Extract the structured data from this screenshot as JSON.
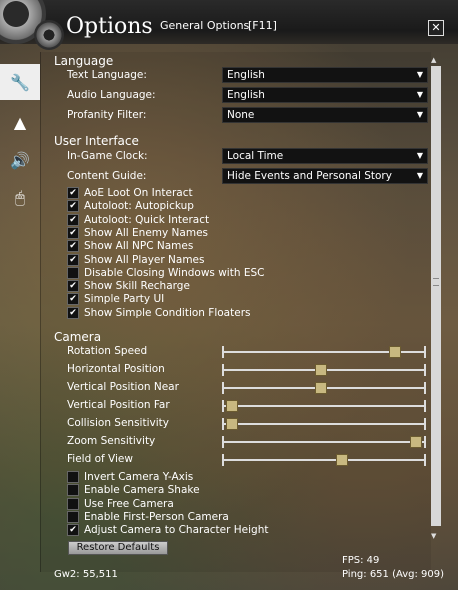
{
  "window": {
    "title": "Options",
    "subtitle": "General Options",
    "hotkey": "[F11]",
    "close_glyph": "✕"
  },
  "sidebar": {
    "tabs": [
      {
        "name": "wrench-icon",
        "glyph": "🔧",
        "active": true
      },
      {
        "name": "mountains-icon",
        "glyph": "▲"
      },
      {
        "name": "speaker-icon",
        "glyph": "🔊"
      },
      {
        "name": "mouse-icon",
        "glyph": "🖱"
      }
    ]
  },
  "language": {
    "header": "Language",
    "text_language": {
      "label": "Text Language:",
      "value": "English"
    },
    "audio_language": {
      "label": "Audio Language:",
      "value": "English"
    },
    "profanity_filter": {
      "label": "Profanity Filter:",
      "value": "None"
    }
  },
  "ui": {
    "header": "User Interface",
    "clock": {
      "label": "In-Game Clock:",
      "value": "Local Time"
    },
    "guide": {
      "label": "Content Guide:",
      "value": "Hide Events and Personal Story"
    },
    "checkboxes": [
      {
        "label": "AoE Loot On Interact",
        "checked": true
      },
      {
        "label": "Autoloot: Autopickup",
        "checked": true
      },
      {
        "label": "Autoloot: Quick Interact",
        "checked": true
      },
      {
        "label": "Show All Enemy Names",
        "checked": true
      },
      {
        "label": "Show All NPC Names",
        "checked": true
      },
      {
        "label": "Show All Player Names",
        "checked": true
      },
      {
        "label": "Disable Closing Windows with ESC",
        "checked": false
      },
      {
        "label": "Show Skill Recharge",
        "checked": true
      },
      {
        "label": "Simple Party UI",
        "checked": true
      },
      {
        "label": "Show Simple Condition Floaters",
        "checked": true
      }
    ]
  },
  "camera": {
    "header": "Camera",
    "sliders": [
      {
        "label": "Rotation Speed",
        "value": 0.86
      },
      {
        "label": "Horizontal Position",
        "value": 0.48
      },
      {
        "label": "Vertical Position Near",
        "value": 0.48
      },
      {
        "label": "Vertical Position Far",
        "value": 0.02
      },
      {
        "label": "Collision Sensitivity",
        "value": 0.02
      },
      {
        "label": "Zoom Sensitivity",
        "value": 0.97
      },
      {
        "label": "Field of View",
        "value": 0.59
      }
    ],
    "checkboxes": [
      {
        "label": "Invert Camera Y-Axis",
        "checked": false
      },
      {
        "label": "Enable Camera Shake",
        "checked": false
      },
      {
        "label": "Use Free Camera",
        "checked": false
      },
      {
        "label": "Enable First-Person Camera",
        "checked": false
      },
      {
        "label": "Adjust Camera to Character Height",
        "checked": true
      }
    ]
  },
  "restore_defaults": "Restore Defaults",
  "footer": {
    "build": "Gw2: 55,511",
    "fps": "FPS: 49",
    "ping": "Ping: 651 (Avg: 909)"
  },
  "glyphs": {
    "dropdown_arrow": "▼",
    "check": "✔",
    "scroll_up": "▲",
    "scroll_down": "▼"
  }
}
